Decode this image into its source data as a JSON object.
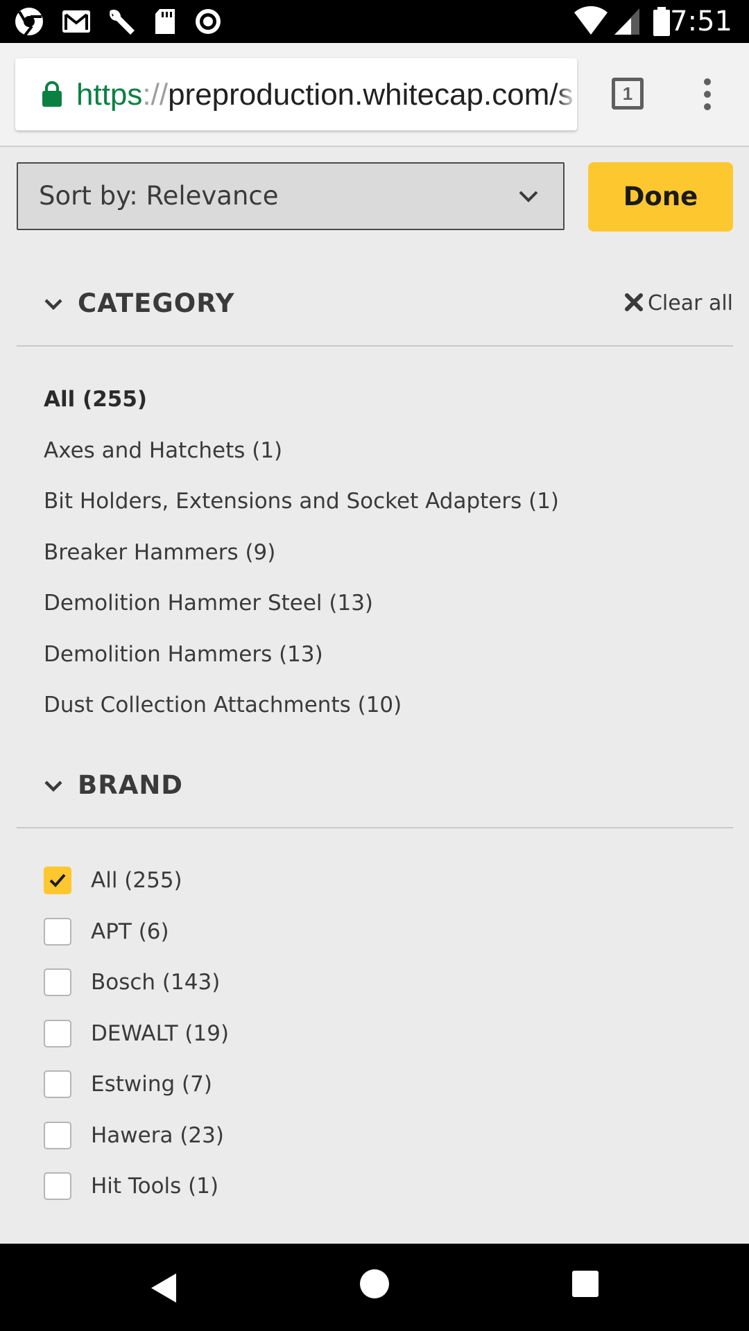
{
  "status_bar": {
    "time": "7:51",
    "icons": [
      "chrome-beta-icon",
      "gmail-icon",
      "wrench-icon",
      "sd-card-icon",
      "record-icon",
      "wifi-icon",
      "signal-icon",
      "battery-icon"
    ]
  },
  "browser": {
    "url_scheme": "https",
    "url_separator": "://",
    "url_rest": "preproduction.whitecap.com/s",
    "tab_count": "1",
    "icons": [
      "lock-icon",
      "tab-switcher-icon",
      "overflow-menu-icon"
    ]
  },
  "toolbar": {
    "sort_label": "Sort by: Relevance",
    "done_label": "Done"
  },
  "category": {
    "title": "CATEGORY",
    "clear_all_label": "Clear all",
    "items": [
      {
        "label": "All (255)",
        "selected": true
      },
      {
        "label": "Axes and Hatchets (1)",
        "selected": false
      },
      {
        "label": "Bit Holders, Extensions and Socket Adapters (1)",
        "selected": false
      },
      {
        "label": "Breaker Hammers (9)",
        "selected": false
      },
      {
        "label": "Demolition Hammer Steel (13)",
        "selected": false
      },
      {
        "label": "Demolition Hammers (13)",
        "selected": false
      },
      {
        "label": "Dust Collection Attachments (10)",
        "selected": false
      }
    ]
  },
  "brand": {
    "title": "BRAND",
    "items": [
      {
        "label": "All (255)",
        "checked": true
      },
      {
        "label": "APT (6)",
        "checked": false
      },
      {
        "label": "Bosch (143)",
        "checked": false
      },
      {
        "label": "DEWALT (19)",
        "checked": false
      },
      {
        "label": "Estwing (7)",
        "checked": false
      },
      {
        "label": "Hawera (23)",
        "checked": false
      },
      {
        "label": "Hit Tools (1)",
        "checked": false
      }
    ]
  },
  "colors": {
    "accent": "#fdc82f",
    "page_background": "#ebebeb",
    "text": "#3a3a3a",
    "secure_scheme": "#0b8043"
  },
  "nav_bar": {
    "icons": [
      "back-icon",
      "home-icon",
      "recents-icon"
    ]
  }
}
